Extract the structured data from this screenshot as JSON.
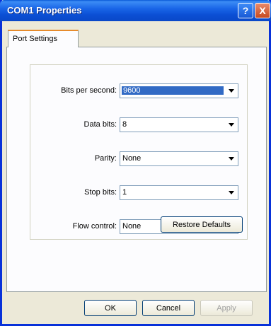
{
  "window": {
    "title": "COM1 Properties",
    "help_label": "?",
    "close_label": "X"
  },
  "tabs": [
    {
      "label": "Port Settings",
      "active": true
    }
  ],
  "settings": [
    {
      "label": "Bits per second:",
      "value": "9600",
      "focused": true
    },
    {
      "label": "Data bits:",
      "value": "8"
    },
    {
      "label": "Parity:",
      "value": "None"
    },
    {
      "label": "Stop bits:",
      "value": "1"
    },
    {
      "label": "Flow control:",
      "value": "None"
    }
  ],
  "buttons": {
    "restore_defaults": "Restore Defaults",
    "ok": "OK",
    "cancel": "Cancel",
    "apply": "Apply"
  },
  "colors": {
    "titlebar": "#0a5ad8",
    "selection": "#316ac5",
    "tab_accent": "#e68b2c"
  }
}
